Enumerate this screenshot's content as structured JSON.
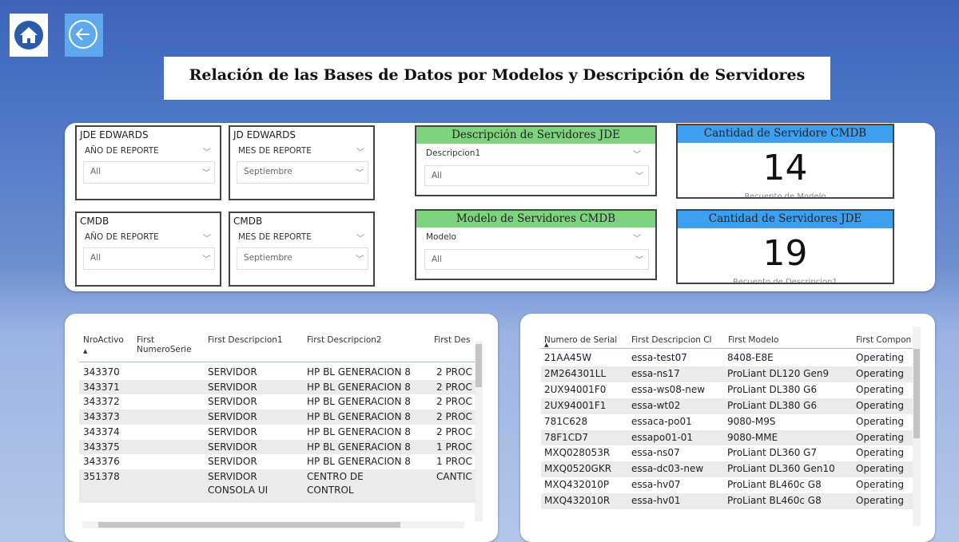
{
  "title": "Relación de las Bases de Datos por Modelos y Descripción de Servidores",
  "nav": {
    "home_icon": "home-icon",
    "back_icon": "back-arrow-icon"
  },
  "slicers": [
    {
      "title": "JDE EDWARDS",
      "label": "AÑO DE REPORTE",
      "value": "All"
    },
    {
      "title": "JD EDWARDS",
      "label": "MES DE REPORTE",
      "value": "Septiembre"
    },
    {
      "title": "CMDB",
      "label": "AÑO DE REPORTE",
      "value": "All"
    },
    {
      "title": "CMDB",
      "label": "MES DE REPORTE",
      "value": "Septiembre"
    }
  ],
  "filter_desc": {
    "header": "Descripción de Servidores JDE",
    "label": "Descripcion1",
    "value": "All"
  },
  "filter_model": {
    "header": "Modelo de Servidores CMDB",
    "label": "Modelo",
    "value": "All"
  },
  "card_cmdb": {
    "header": "Cantidad de Servidore CMDB",
    "value": "14",
    "sub": "Recuento de Modelo"
  },
  "card_jde": {
    "header": "Cantidad de Servidores JDE",
    "value": "19",
    "sub": "Recuento de Descripcion1"
  },
  "table_left": {
    "headers": [
      "NroActivo",
      "First NumeroSerie",
      "First Descripcion1",
      "First Descripcion2",
      "First Des"
    ],
    "rows": [
      [
        "343370",
        "",
        "SERVIDOR",
        "HP BL GENERACION 8",
        "2 PROC"
      ],
      [
        "343371",
        "",
        "SERVIDOR",
        "HP BL GENERACION 8",
        "2 PROC"
      ],
      [
        "343372",
        "",
        "SERVIDOR",
        "HP BL GENERACION 8",
        "2 PROC"
      ],
      [
        "343373",
        "",
        "SERVIDOR",
        "HP BL GENERACION 8",
        "2 PROC"
      ],
      [
        "343374",
        "",
        "SERVIDOR",
        "HP BL GENERACION 8",
        "2 PROC"
      ],
      [
        "343375",
        "",
        "SERVIDOR",
        "HP BL GENERACION 8",
        "1 PROC"
      ],
      [
        "343376",
        "",
        "SERVIDOR",
        "HP BL GENERACION 8",
        "1 PROC"
      ]
    ],
    "last_row": {
      "c0": "351378",
      "c2a": "SERVIDOR",
      "c2b": "CONSOLA UI",
      "c3a": "CENTRO DE",
      "c3b": "CONTROL",
      "c4": "CANTIC"
    }
  },
  "table_right": {
    "headers": [
      "Numero de Serial",
      "First Descripcion CI",
      "First Modelo",
      "First Compon"
    ],
    "rows": [
      [
        "21AA45W",
        "essa-test07",
        "8408-E8E",
        "Operating"
      ],
      [
        "2M264301LL",
        "essa-ns17",
        "ProLiant DL120 Gen9",
        "Operating"
      ],
      [
        "2UX94001F0",
        "essa-ws08-new",
        "ProLiant DL380 G6",
        "Operating"
      ],
      [
        "2UX94001F1",
        "essa-wt02",
        "ProLiant DL380 G6",
        "Operating"
      ],
      [
        "781C628",
        "essaca-po01",
        "9080-M9S",
        "Operating"
      ],
      [
        "78F1CD7",
        "essapo01-01",
        "9080-MME",
        "Operating"
      ],
      [
        "MXQ028053R",
        "essa-ns07",
        "ProLiant DL360 G7",
        "Operating"
      ],
      [
        "MXQ0520GKR",
        "essa-dc03-new",
        "ProLiant DL360 Gen10",
        "Operating"
      ],
      [
        "MXQ432010P",
        "essa-hv07",
        "ProLiant BL460c G8",
        "Operating"
      ],
      [
        "MXQ432010R",
        "essa-hv01",
        "ProLiant BL460c G8",
        "Operating"
      ]
    ]
  }
}
